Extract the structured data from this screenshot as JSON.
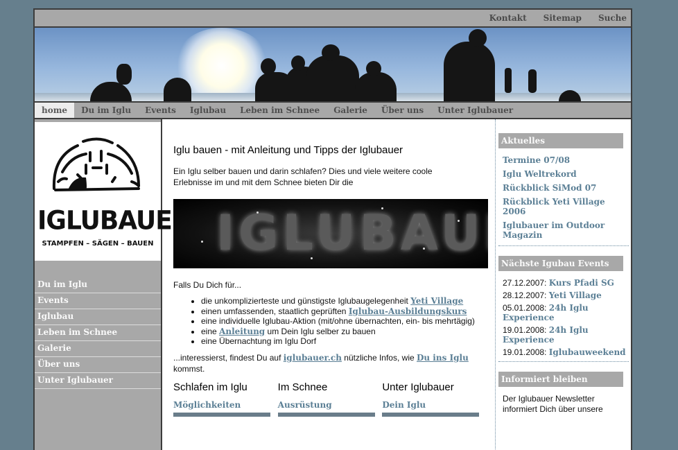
{
  "topbar": {
    "links": [
      "Kontakt",
      "Sitemap",
      "Suche"
    ]
  },
  "nav": {
    "items": [
      "home",
      "Du im Iglu",
      "Events",
      "Iglubau",
      "Leben im Schnee",
      "Galerie",
      "Über uns",
      "Unter Iglubauer"
    ],
    "active": "home"
  },
  "logo": {
    "title": "IGLUBAUER",
    "tagline": "STAMPFEN – SÄGEN – BAUEN"
  },
  "sidenav": {
    "items": [
      "Du im Iglu",
      "Events",
      "Iglubau",
      "Leben im Schnee",
      "Galerie",
      "Über uns",
      "Unter Iglubauer"
    ]
  },
  "main": {
    "headline": "Iglu bauen - mit Anleitung und Tipps der Iglubauer",
    "intro": "Ein Iglu selber bauen und darin schlafen? Dies und viele weitere coole Erlebnisse im und mit dem Schnee bieten Dir die",
    "picture_text": "IGLUBAUER",
    "falls": "Falls Du Dich für...",
    "bullets": [
      {
        "text": "die unkomplizierteste und günstigste Iglubaugelegenheit ",
        "link": "Yeti Village",
        "after": ""
      },
      {
        "text": "einen umfassenden, staatlich geprüften ",
        "link": "Iglubau-Ausbildungskurs",
        "after": ""
      },
      {
        "text": "eine individuelle Iglubau-Aktion (mit/ohne übernachten, ein- bis mehrtägig)",
        "link": "",
        "after": ""
      },
      {
        "text": "eine ",
        "link": "Anleitung",
        "after": " um Dein Iglu selber zu bauen"
      },
      {
        "text": "eine Übernachtung im Iglu Dorf",
        "link": "",
        "after": ""
      }
    ],
    "closing": {
      "t1": "...interessierst, findest Du auf ",
      "l1": "iglubauer.ch",
      "t2": " nützliche Infos, wie ",
      "l2": "Du ins Iglu",
      "t3": " kommst."
    },
    "columns": [
      {
        "heading": "Schlafen im Iglu",
        "link": "Möglichkeiten"
      },
      {
        "heading": "Im Schnee",
        "link": "Ausrüstung"
      },
      {
        "heading": "Unter Iglubauer",
        "link": "Dein Iglu"
      }
    ]
  },
  "right": {
    "aktuelles": {
      "heading": "Aktuelles",
      "links": [
        "Termine 07/08",
        "Iglu Weltrekord",
        "Rückblick SiMod 07",
        "Rückblick Yeti Village 2006",
        "Iglubauer im Outdoor Magazin"
      ]
    },
    "events": {
      "heading": "Nächste Igubau Events",
      "items": [
        {
          "date": "27.12.2007: ",
          "name": "Kurs Pfadi SG"
        },
        {
          "date": "28.12.2007: ",
          "name": "Yeti Village"
        },
        {
          "date": "05.01.2008: ",
          "name": "24h Iglu Experience"
        },
        {
          "date": "19.01.2008: ",
          "name": "24h Iglu Experience"
        },
        {
          "date": "19.01.2008: ",
          "name": "Iglubauweekend"
        }
      ]
    },
    "informiert": {
      "heading": "Informiert bleiben",
      "text": "Der Iglubauer Newsletter informiert Dich über unsere"
    }
  }
}
